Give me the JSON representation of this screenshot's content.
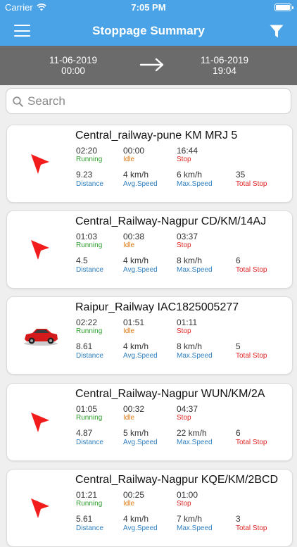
{
  "status_bar": {
    "carrier": "Carrier",
    "time": "7:05 PM"
  },
  "nav": {
    "title": "Stoppage Summary",
    "menu_icon": "hamburger-menu-icon",
    "filter_icon": "filter-funnel-icon"
  },
  "date_range": {
    "from_date": "11-06-2019",
    "from_time": "00:00",
    "to_date": "11-06-2019",
    "to_time": "19:04"
  },
  "search": {
    "placeholder": "Search"
  },
  "labels": {
    "running": "Running",
    "idle": "Idle",
    "stop": "Stop",
    "distance": "Distance",
    "avg_speed": "Avg.Speed",
    "max_speed": "Max.Speed",
    "total_stop": "Total Stop"
  },
  "colors": {
    "header": "#4aa3e6",
    "date_bar": "#6b6b6b",
    "running": "#2e9e2e",
    "idle": "#e07a12",
    "stop": "#e02424",
    "metric_label": "#2f7fc0"
  },
  "vehicles": [
    {
      "name": "Central_railway-pune   KM MRJ 5",
      "icon": "red-arrow-icon",
      "running": "02:20",
      "idle": "00:00",
      "stop": "16:44",
      "distance": "9.23",
      "avg_speed": "4 km/h",
      "max_speed": "6 km/h",
      "total_stop": "35"
    },
    {
      "name": "Central_Railway-Nagpur   CD/KM/14AJ",
      "icon": "red-arrow-icon",
      "running": "01:03",
      "idle": "00:38",
      "stop": "03:37",
      "distance": "4.5",
      "avg_speed": "4 km/h",
      "max_speed": "8 km/h",
      "total_stop": "6"
    },
    {
      "name": "Raipur_Railway   IAC1825005277",
      "icon": "red-car-icon",
      "running": "02:22",
      "idle": "01:51",
      "stop": "01:11",
      "distance": "8.61",
      "avg_speed": "4 km/h",
      "max_speed": "8 km/h",
      "total_stop": "5"
    },
    {
      "name": "Central_Railway-Nagpur   WUN/KM/2A",
      "icon": "red-arrow-icon",
      "running": "01:05",
      "idle": "00:32",
      "stop": "04:37",
      "distance": "4.87",
      "avg_speed": "5 km/h",
      "max_speed": "22 km/h",
      "total_stop": "6"
    },
    {
      "name": "Central_Railway-Nagpur   KQE/KM/2BCD",
      "icon": "red-arrow-icon",
      "running": "01:21",
      "idle": "00:25",
      "stop": "01:00",
      "distance": "5.61",
      "avg_speed": "4 km/h",
      "max_speed": "7 km/h",
      "total_stop": "3"
    }
  ]
}
